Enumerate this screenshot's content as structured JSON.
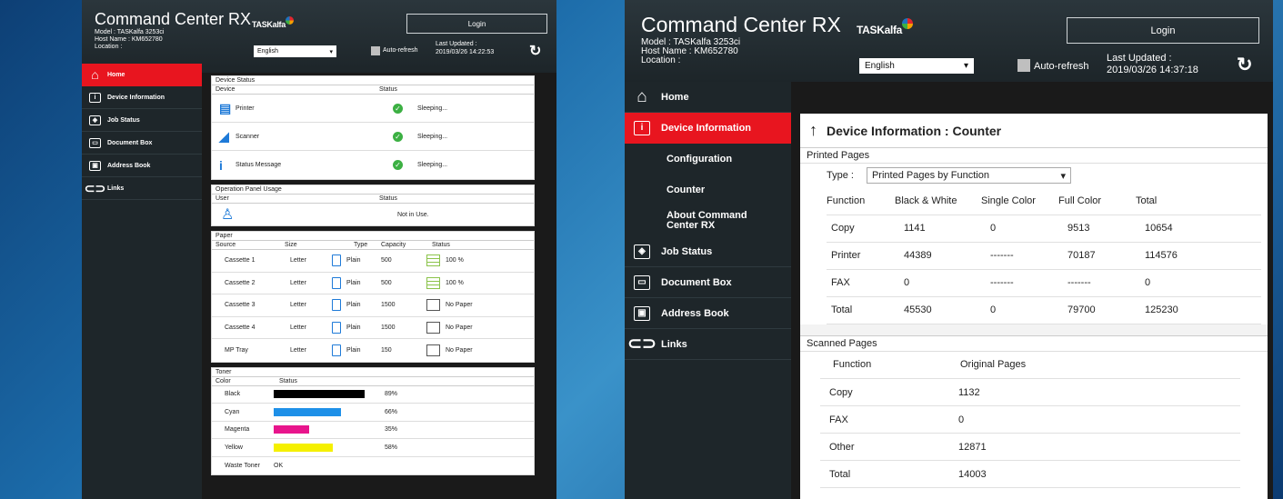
{
  "left": {
    "brand": "Command Center RX",
    "model": "Model : TASKalfa 3253ci",
    "host": "Host Name : KM652780",
    "location": "Location :",
    "logo": "TASKalfa",
    "login": "Login",
    "language": "English",
    "auto_refresh": "Auto-refresh",
    "updated_label": "Last Updated :",
    "updated_value": "2019/03/26 14:22:53",
    "nav": [
      {
        "label": "Home",
        "icon": "home-icon",
        "active": true
      },
      {
        "label": "Device Information",
        "icon": "device-info-icon"
      },
      {
        "label": "Job Status",
        "icon": "job-status-icon"
      },
      {
        "label": "Document Box",
        "icon": "document-box-icon"
      },
      {
        "label": "Address Book",
        "icon": "address-book-icon"
      },
      {
        "label": "Links",
        "icon": "links-icon"
      }
    ],
    "device_status": {
      "title": "Device Status",
      "col_device": "Device",
      "col_status": "Status",
      "rows": [
        {
          "name": "Printer",
          "status": "Sleeping..."
        },
        {
          "name": "Scanner",
          "status": "Sleeping..."
        },
        {
          "name": "Status Message",
          "status": "Sleeping..."
        }
      ]
    },
    "panel_usage": {
      "title": "Operation Panel Usage",
      "col_user": "User",
      "col_status": "Status",
      "status": "Not in Use."
    },
    "paper": {
      "title": "Paper",
      "headers": [
        "Source",
        "Size",
        "Type",
        "Capacity",
        "Status"
      ],
      "rows": [
        {
          "source": "Cassette 1",
          "size": "Letter",
          "type": "Plain",
          "capacity": "500",
          "status": "100 %",
          "level": 1.0
        },
        {
          "source": "Cassette 2",
          "size": "Letter",
          "type": "Plain",
          "capacity": "500",
          "status": "100 %",
          "level": 1.0
        },
        {
          "source": "Cassette 3",
          "size": "Letter",
          "type": "Plain",
          "capacity": "1500",
          "status": "No Paper",
          "level": 0
        },
        {
          "source": "Cassette 4",
          "size": "Letter",
          "type": "Plain",
          "capacity": "1500",
          "status": "No Paper",
          "level": 0
        },
        {
          "source": "MP Tray",
          "size": "Letter",
          "type": "Plain",
          "capacity": "150",
          "status": "No Paper",
          "level": 0
        }
      ]
    },
    "toner": {
      "title": "Toner",
      "col_color": "Color",
      "col_status": "Status",
      "rows": [
        {
          "name": "Black",
          "pct": "89%",
          "level": 0.89,
          "color": "#000000"
        },
        {
          "name": "Cyan",
          "pct": "66%",
          "level": 0.66,
          "color": "#1e90e8"
        },
        {
          "name": "Magenta",
          "pct": "35%",
          "level": 0.35,
          "color": "#e8158c"
        },
        {
          "name": "Yellow",
          "pct": "58%",
          "level": 0.58,
          "color": "#f5f000"
        }
      ],
      "waste_label": "Waste Toner",
      "waste_status": "OK"
    }
  },
  "right": {
    "brand": "Command Center RX",
    "model": "Model : TASKalfa 3253ci",
    "host": "Host Name : KM652780",
    "location": "Location :",
    "logo": "TASKalfa",
    "login": "Login",
    "language": "English",
    "auto_refresh": "Auto-refresh",
    "updated_label": "Last Updated :",
    "updated_value": "2019/03/26 14:37:18",
    "nav_home": "Home",
    "nav_device": "Device Information",
    "sub": [
      "Configuration",
      "Counter",
      "About Command Center RX"
    ],
    "nav_rest": [
      {
        "label": "Job Status",
        "icon": "job-status-icon"
      },
      {
        "label": "Document Box",
        "icon": "document-box-icon"
      },
      {
        "label": "Address Book",
        "icon": "address-book-icon"
      },
      {
        "label": "Links",
        "icon": "links-icon"
      }
    ],
    "page_title": "Device Information : Counter",
    "printed": {
      "title": "Printed Pages",
      "type_label": "Type :",
      "type_value": "Printed Pages by Function",
      "headers": [
        "Function",
        "Black & White",
        "Single Color",
        "Full Color",
        "Total"
      ],
      "rows": [
        [
          "Copy",
          "1141",
          "0",
          "9513",
          "10654"
        ],
        [
          "Printer",
          "44389",
          "-------",
          "70187",
          "114576"
        ],
        [
          "FAX",
          "0",
          "-------",
          "-------",
          "0"
        ],
        [
          "Total",
          "45530",
          "0",
          "79700",
          "125230"
        ]
      ]
    },
    "scanned": {
      "title": "Scanned Pages",
      "headers": [
        "Function",
        "Original Pages"
      ],
      "rows": [
        [
          "Copy",
          "1132"
        ],
        [
          "FAX",
          "0"
        ],
        [
          "Other",
          "12871"
        ],
        [
          "Total",
          "14003"
        ]
      ]
    }
  }
}
